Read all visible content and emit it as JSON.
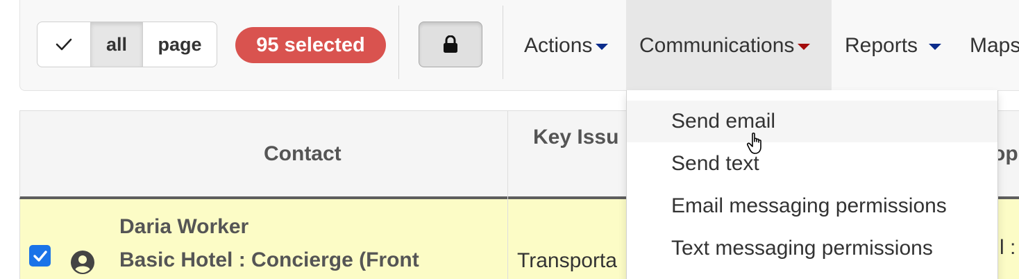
{
  "toolbar": {
    "select_all_label": "all",
    "select_page_label": "page",
    "selected_badge": "95 selected",
    "menus": {
      "actions": "Actions",
      "communications": "Communications",
      "reports": "Reports",
      "maps": "Maps"
    }
  },
  "table": {
    "headers": {
      "contact": "Contact",
      "key_issues": "Key Issu",
      "third": "op"
    },
    "rows": [
      {
        "name": "Daria Worker",
        "employer": "Basic Hotel : Concierge (Front",
        "key_issue": "Transporta",
        "third_col": "l :"
      }
    ]
  },
  "dropdown": {
    "items": [
      "Send email",
      "Send text",
      "Email messaging permissions",
      "Text messaging permissions"
    ]
  },
  "colors": {
    "badge": "#d9534f",
    "caret_navy": "#0b2c8c",
    "caret_red": "#a40c0c",
    "row_highlight": "#fcfcc6",
    "checkbox": "#1a73e8"
  }
}
